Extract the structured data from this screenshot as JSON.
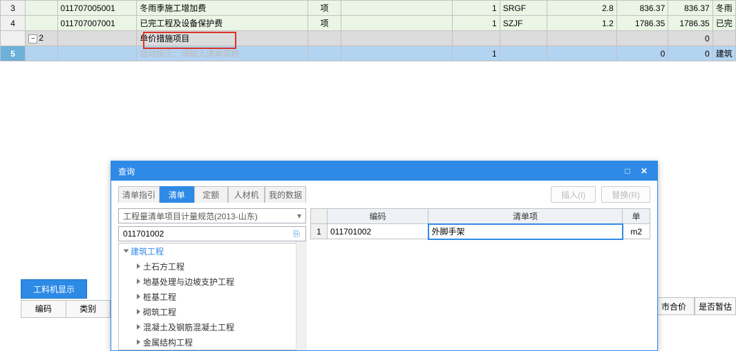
{
  "grid": {
    "rows": [
      {
        "num": "3",
        "code": "011707005001",
        "name": "冬雨季施工增加费",
        "unit": "项",
        "qty": "1",
        "abbr": "SRGF",
        "rate": "2.8",
        "price": "836.37",
        "total": "836.37",
        "desc": "冬雨"
      },
      {
        "num": "4",
        "code": "011707007001",
        "name": "已完工程及设备保护费",
        "unit": "项",
        "qty": "1",
        "abbr": "SZJF",
        "rate": "1.2",
        "price": "1786.35",
        "total": "1786.35",
        "desc": "已完"
      }
    ],
    "grouprow": {
      "treeval": "2",
      "name": "单价措施项目",
      "total": "0"
    },
    "editrow": {
      "num": "5",
      "placeholder": "自动提示：请输入清单简称",
      "qty": "1",
      "total": "0",
      "total2": "0",
      "desc": "建筑"
    }
  },
  "bottom": {
    "btn": "工料机显示",
    "tab1": "编码",
    "tab2": "类别",
    "far1": "市合价",
    "far2": "是否暂估"
  },
  "dlg": {
    "title": "查询",
    "tabs": [
      "清单指引",
      "清单",
      "定额",
      "人材机",
      "我的数据"
    ],
    "tabActive": 1,
    "btnInsert": "插入(I)",
    "btnReplace": "替换(R)",
    "selectval": "工程量清单项目计量规范(2013-山东)",
    "searchval": "011701002",
    "treeRoot": "建筑工程",
    "treeChildren": [
      "土石方工程",
      "地基处理与边坡支护工程",
      "桩基工程",
      "砌筑工程",
      "混凝土及钢筋混凝土工程",
      "金属结构工程"
    ],
    "rhdr": {
      "code": "编码",
      "name": "清单项",
      "unit": "单"
    },
    "rrow": {
      "n": "1",
      "code": "011701002",
      "name": "外脚手架",
      "unit": "m2"
    }
  }
}
